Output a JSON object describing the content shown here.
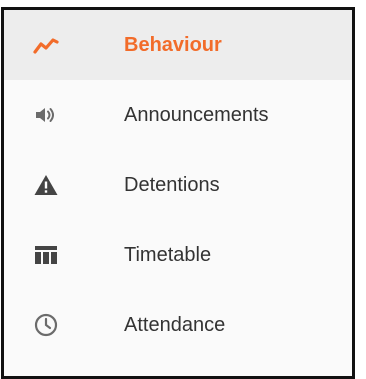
{
  "colors": {
    "accent": "#f26c2a",
    "icon": "#6b6b6b",
    "icon_dark": "#444444",
    "text": "#333333",
    "active_bg": "#ededed"
  },
  "nav": {
    "items": [
      {
        "label": "Behaviour",
        "icon": "trend-line-icon",
        "active": true
      },
      {
        "label": "Announcements",
        "icon": "speaker-icon",
        "active": false
      },
      {
        "label": "Detentions",
        "icon": "warning-icon",
        "active": false
      },
      {
        "label": "Timetable",
        "icon": "timetable-icon",
        "active": false
      },
      {
        "label": "Attendance",
        "icon": "clock-icon",
        "active": false
      }
    ]
  }
}
